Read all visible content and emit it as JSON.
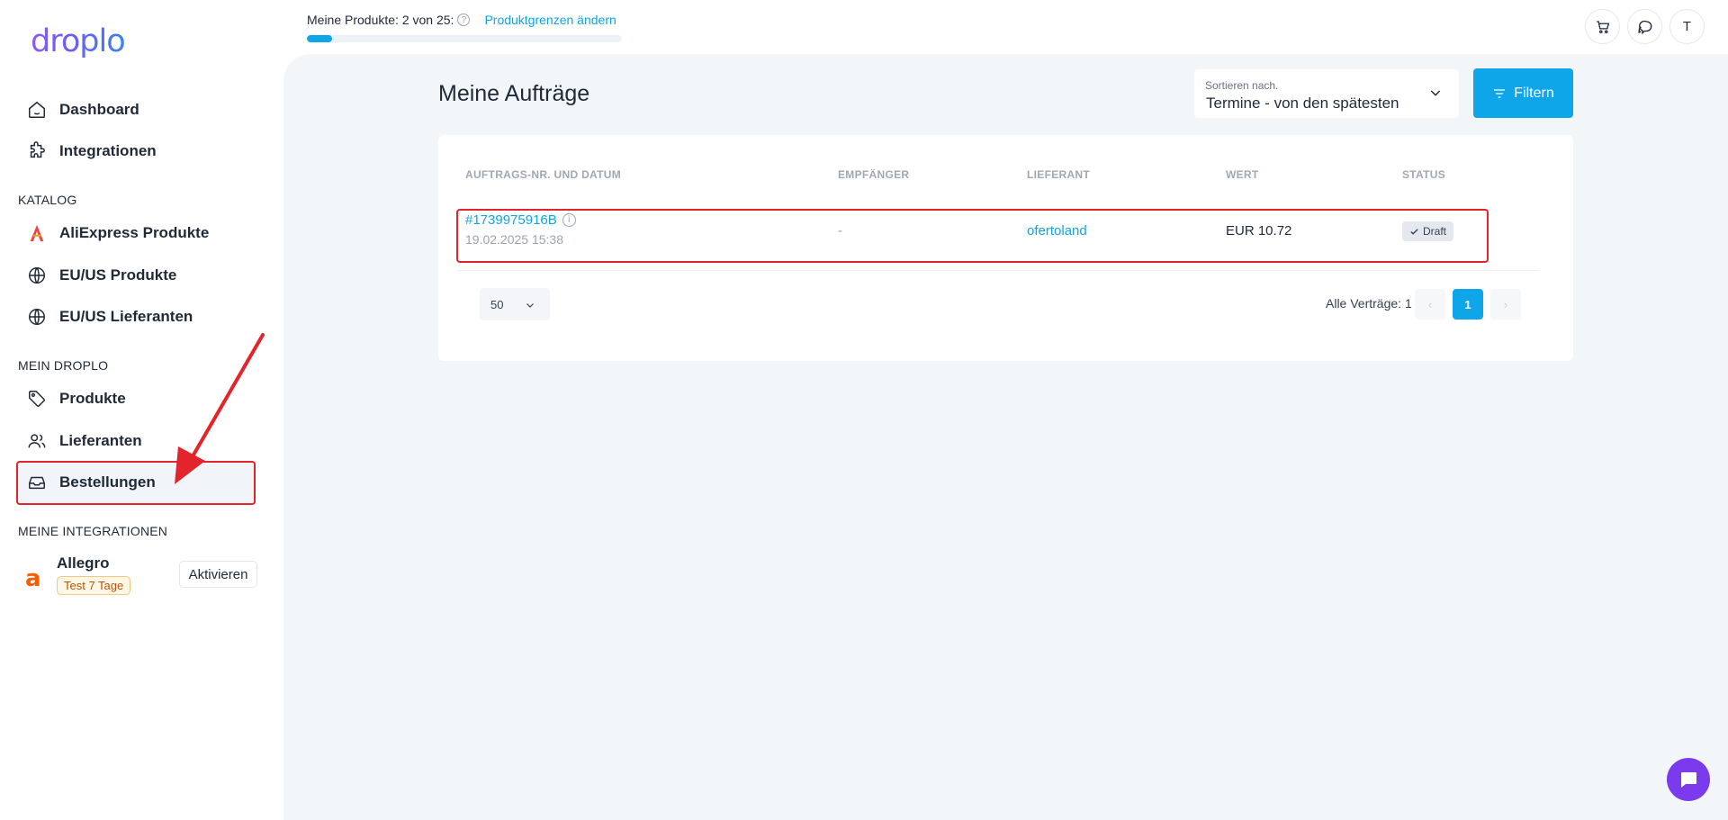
{
  "brand": {
    "logo_text": "droplo"
  },
  "topbar": {
    "products_label": "Meine Produkte: 2 von 25:",
    "limits_link": "Produktgrenzen ändern",
    "progress_fraction": 0.08,
    "avatar_letter": "T"
  },
  "sidebar": {
    "items": [
      {
        "label": "Dashboard",
        "icon": "home-icon"
      },
      {
        "label": "Integrationen",
        "icon": "puzzle-icon"
      }
    ],
    "catalog_title": "KATALOG",
    "catalog_items": [
      {
        "label": "AliExpress Produkte",
        "icon": "aliexpress-icon"
      },
      {
        "label": "EU/US Produkte",
        "icon": "globe-icon"
      },
      {
        "label": "EU/US Lieferanten",
        "icon": "globe-icon"
      }
    ],
    "mydroplo_title": "MEIN DROPLO",
    "mydroplo_items": [
      {
        "label": "Produkte",
        "icon": "tag-icon"
      },
      {
        "label": "Lieferanten",
        "icon": "users-icon"
      },
      {
        "label": "Bestellungen",
        "icon": "inbox-icon",
        "active": true
      }
    ],
    "integrations_title": "MEINE INTEGRATIONEN",
    "integration": {
      "logo_letter": "a",
      "name": "Allegro",
      "badge": "Test 7 Tage",
      "button": "Aktivieren"
    }
  },
  "main": {
    "title": "Meine Aufträge",
    "sort": {
      "caption": "Sortieren nach.",
      "value": "Termine - von den spätesten"
    },
    "filter_button": "Filtern",
    "table": {
      "headers": [
        "AUFTRAGS-NR. UND DATUM",
        "EMPFÄNGER",
        "LIEFERANT",
        "WERT",
        "STATUS"
      ],
      "rows": [
        {
          "order_id": "#1739975916B",
          "date": "19.02.2025 15:38",
          "recipient": "-",
          "supplier": "ofertoland",
          "value": "EUR 10.72",
          "status": "Draft"
        }
      ]
    },
    "pagination": {
      "per_page": "50",
      "total_label": "Alle Verträge: 1",
      "current_page": "1",
      "prev_symbol": "‹",
      "next_symbol": "›"
    }
  },
  "colors": {
    "accent": "#0ea5e9",
    "highlight": "#e3242b",
    "brand_purple": "#7c3aed",
    "background": "#f3f6f9"
  }
}
